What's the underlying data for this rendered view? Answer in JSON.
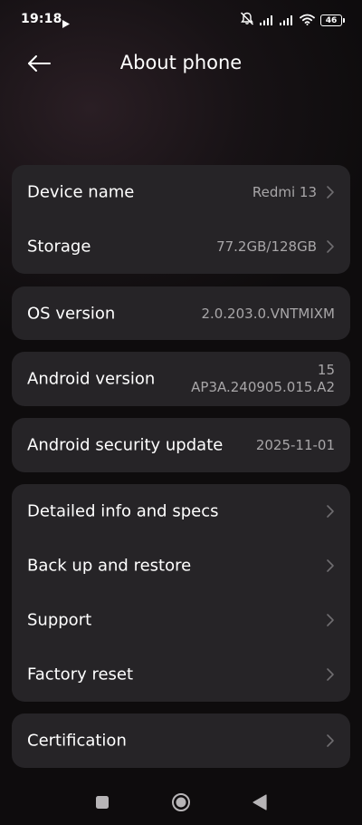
{
  "status_bar": {
    "time": "19:18",
    "battery": "46",
    "icons": [
      "play-icon",
      "mute-icon",
      "signal-icon",
      "signal-icon",
      "wifi-icon",
      "battery-icon"
    ]
  },
  "header": {
    "title": "About phone",
    "back_icon": "arrow-left-icon"
  },
  "device_card": {
    "device_name_label": "Device name",
    "device_name_value": "Redmi 13",
    "storage_label": "Storage",
    "storage_value": "77.2GB/128GB"
  },
  "os_card": {
    "label": "OS version",
    "value": "2.0.203.0.VNTMIXM"
  },
  "android_card": {
    "label": "Android version",
    "value_line1": "15",
    "value_line2": "AP3A.240905.015.A2"
  },
  "security_card": {
    "label": "Android security update",
    "value": "2025-11-01"
  },
  "more_card": {
    "items": [
      {
        "label": "Detailed info and specs"
      },
      {
        "label": "Back up and restore"
      },
      {
        "label": "Support"
      },
      {
        "label": "Factory reset"
      }
    ]
  },
  "cert_card": {
    "label": "Certification"
  },
  "nav_bar": {
    "icons": [
      "recents-square-icon",
      "home-circle-icon",
      "back-triangle-icon"
    ]
  },
  "colors": {
    "card_bg": "#262427",
    "value_text": "#a8a6a8",
    "chevron": "#6f6d70"
  }
}
